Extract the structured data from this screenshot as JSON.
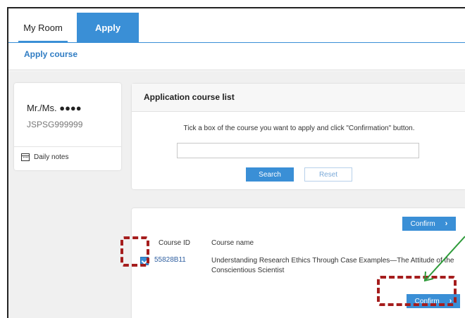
{
  "tabs": [
    {
      "label": "My Room",
      "active": false
    },
    {
      "label": "Apply",
      "active": true
    }
  ],
  "subnav": {
    "label": "Apply course"
  },
  "profile": {
    "name": "Mr./Ms. ●●●●",
    "id": "JSPSG999999",
    "notes_label": "Daily notes",
    "notes_icon": "calendar-icon"
  },
  "application_list": {
    "title": "Application course list",
    "instruction": "Tick a box of the course you want to apply and click \"Confirmation\" button.",
    "search_value": "",
    "search_label": "Search",
    "reset_label": "Reset"
  },
  "course_table": {
    "confirm_label": "Confirm",
    "confirm_chevron": "›",
    "headers": {
      "id": "Course ID",
      "name": "Course name"
    },
    "rows": [
      {
        "checked": true,
        "id": "55828B11",
        "name": "Understanding Research Ethics Through Case Examples—The Attitude of the Conscientious Scientist"
      }
    ]
  },
  "colors": {
    "accent": "#3a8fd6",
    "highlight": "#a51d1d",
    "arrow": "#2e9b3a",
    "background": "#f0f0f0"
  }
}
